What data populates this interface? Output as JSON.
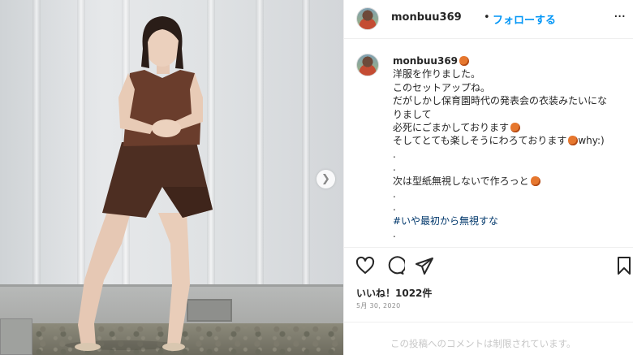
{
  "post": {
    "username": "monbuu369",
    "separator": "•",
    "follow_label": "フォローする",
    "more_label": "···"
  },
  "caption": {
    "username": "monbuu369",
    "lines": [
      "洋服を作りました。",
      "このセットアップね。",
      "だがしかし保育園時代の発表会の衣装みたいにな",
      "りまして",
      "必死にごまかしております",
      "そしてとても楽しそうにわろております",
      ".",
      ".",
      "次は型紙無視しないで作ろっと",
      ".",
      "."
    ],
    "why_text": "why:)",
    "hashtag": "#いや最初から無視すな",
    "trailing": "."
  },
  "stats": {
    "likes": "いいね！1022件",
    "date": "5月 30, 2020"
  },
  "comments": {
    "disabled_notice": "この投稿へのコメントは制限されています。"
  },
  "icons": {
    "like": "heart-icon",
    "comment": "comment-icon",
    "share": "share-icon",
    "save": "bookmark-icon",
    "next": "chevron-right-icon"
  },
  "colors": {
    "accent": "#0095f6",
    "hashtag": "#00376b",
    "muted": "#8e8e8e"
  }
}
